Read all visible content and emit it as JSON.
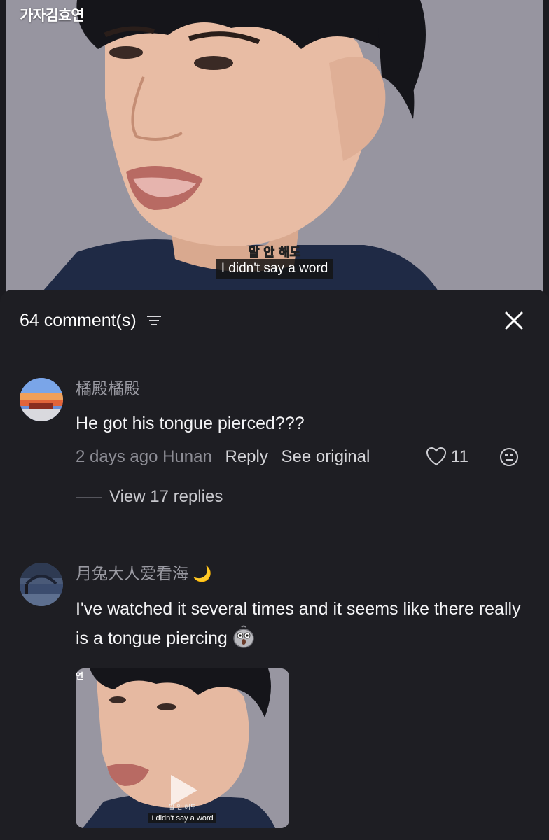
{
  "video": {
    "channel_logo": "가자김효연",
    "subtitle_korean": "말 안 해도",
    "subtitle_english": "I didn't say a word"
  },
  "comments_panel": {
    "count_label": "64 comment(s)",
    "filter_icon": "sort-filter-icon",
    "close_icon": "close-icon"
  },
  "comments": [
    {
      "username": "橘殿橘殿",
      "text": "He got his tongue pierced???",
      "time": "2 days ago",
      "location": "Hunan",
      "reply_label": "Reply",
      "see_original_label": "See original",
      "likes": "11",
      "view_replies_label": "View 17 replies"
    },
    {
      "username": "月兔大人爱看海",
      "username_emoji": "🌙",
      "text": "I've watched it several times and it seems like there really is a tongue piercing",
      "text_emoji": "pigeon-shocked-emoji",
      "thumbnail": {
        "logo_fragment": "연",
        "subtitle_korean": "말 안 해도",
        "subtitle_english": "I didn't say a word"
      }
    }
  ],
  "colors": {
    "sheet_bg": "#1e1e23",
    "muted_text": "#9a9aa2",
    "primary_text": "#f4f4f6"
  }
}
